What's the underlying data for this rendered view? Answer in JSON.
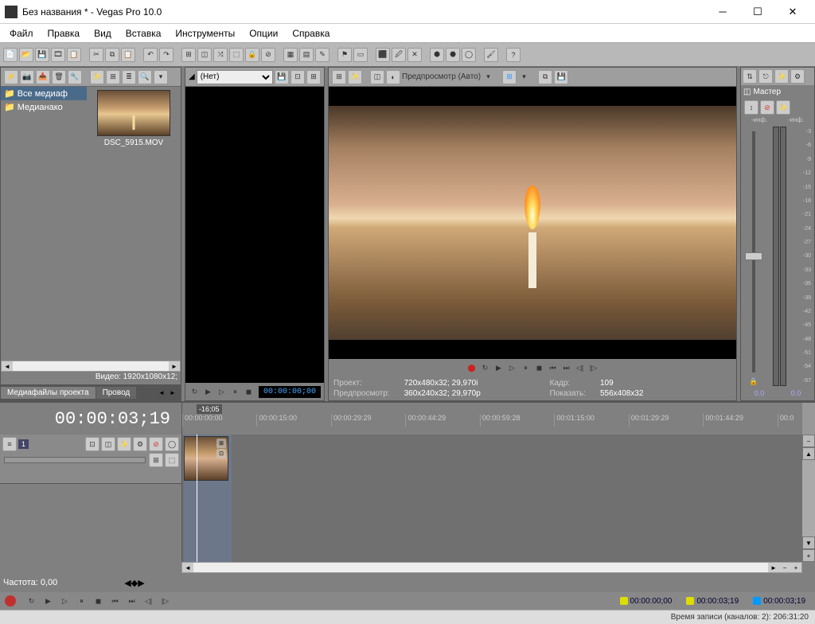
{
  "window": {
    "title": "Без названия * - Vegas Pro 10.0"
  },
  "menu": [
    "Файл",
    "Правка",
    "Вид",
    "Вставка",
    "Инструменты",
    "Опции",
    "Справка"
  ],
  "media": {
    "tree": [
      {
        "label": "Все медиаф",
        "selected": true
      },
      {
        "label": "Медианако",
        "selected": false
      }
    ],
    "thumb_label": "DSC_5915.MOV",
    "status": "Видео: 1920x1080x12;",
    "tabs": [
      {
        "label": "Медиафайлы проекта",
        "active": true
      },
      {
        "label": "Провод",
        "active": false
      }
    ]
  },
  "trimmer": {
    "dropdown": "(Нет)",
    "timecode": "00:00:00;00"
  },
  "preview": {
    "label": "Предпросмотр (Авто)",
    "info": {
      "project_label": "Проект:",
      "project_value": "720x480x32; 29,970i",
      "preview_label": "Предпросмотр:",
      "preview_value": "360x240x32; 29,970p",
      "frame_label": "Кадр:",
      "frame_value": "109",
      "show_label": "Показать:",
      "show_value": "556x408x32"
    }
  },
  "master": {
    "title": "Мастер",
    "scale": [
      "-3",
      "-6",
      "-9",
      "-12",
      "-15",
      "-18",
      "-21",
      "-24",
      "-27",
      "-30",
      "-33",
      "-36",
      "-39",
      "-42",
      "-45",
      "-48",
      "-51",
      "-54",
      "-57"
    ],
    "inf": "-инф.",
    "footer_left": "0.0",
    "footer_right": "0.0"
  },
  "timeline": {
    "big_time": "00:00:03;19",
    "cursor_label": "-16;05",
    "ruler": [
      "00:00:00:00",
      "00:00:15:00",
      "00:00:29:29",
      "00:00:44:29",
      "00:00:59:28",
      "00:01:15:00",
      "00:01:29:29",
      "00:01:44:29",
      "00:0"
    ],
    "track_num": "1",
    "freq_label": "Частота: 0,00"
  },
  "status": {
    "chip1": "00:00:00;00",
    "chip2": "00:00:03;19",
    "chip3": "00:00:03;19",
    "row2": "Время записи (каналов: 2): 206:31:20"
  }
}
